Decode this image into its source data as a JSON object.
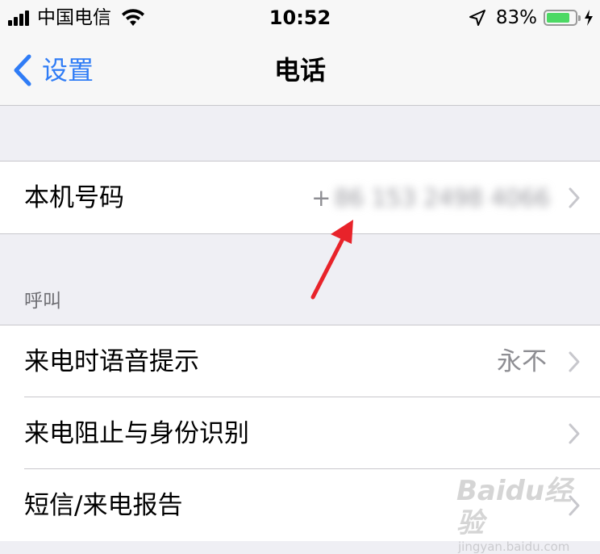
{
  "status_bar": {
    "carrier": "中国电信",
    "time": "10:52",
    "battery_percent": "83%",
    "battery_level": 0.83
  },
  "nav": {
    "back_label": "设置",
    "title": "电话"
  },
  "my_number": {
    "label": "本机号码",
    "value_prefix": "+",
    "value_obscured": "86 153 2498 4066"
  },
  "calls": {
    "header": "呼叫",
    "items": [
      {
        "label": "来电时语音提示",
        "value": "永不"
      },
      {
        "label": "来电阻止与身份识别",
        "value": ""
      },
      {
        "label": "短信/来电报告",
        "value": ""
      }
    ]
  },
  "watermark": {
    "main": "Baidu经验",
    "sub": "jingyan.baidu.com"
  },
  "colors": {
    "accent": "#2f7cf6",
    "battery": "#4cd964",
    "annotation": "#e8232a"
  }
}
